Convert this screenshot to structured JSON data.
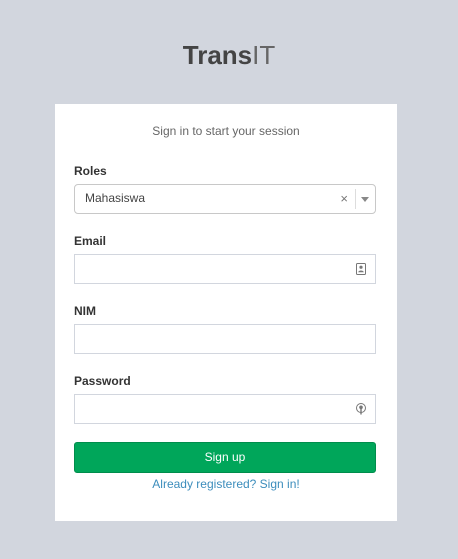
{
  "logo": {
    "bold": "Trans",
    "light": "IT"
  },
  "box": {
    "subtitle": "Sign in to start your session",
    "roles": {
      "label": "Roles",
      "value": "Mahasiswa",
      "clear": "×"
    },
    "email": {
      "label": "Email",
      "value": "",
      "icon": "contact-card-icon"
    },
    "nim": {
      "label": "NIM",
      "value": ""
    },
    "password": {
      "label": "Password",
      "value": "",
      "icon": "key-icon"
    },
    "submit_label": "Sign up",
    "signin_link": "Already registered? Sign in!"
  },
  "colors": {
    "background": "#d2d6de",
    "button": "#00a65a",
    "link": "#3c8dbc"
  }
}
